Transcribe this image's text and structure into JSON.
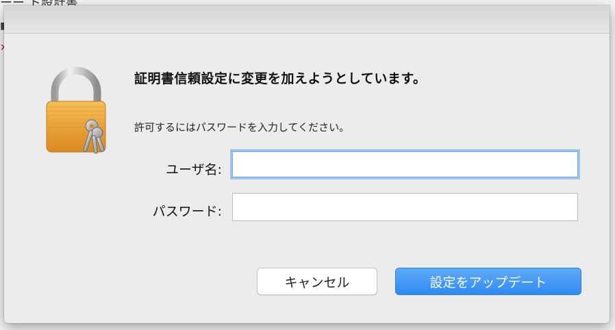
{
  "background": {
    "title_fragment": "ーー ト設計書"
  },
  "dialog": {
    "heading": "証明書信頼設定に変更を加えようとしています。",
    "subtext": "許可するにはパスワードを入力してください。",
    "username_label": "ユーザ名:",
    "username_value": "",
    "password_label": "パスワード:",
    "password_value": "",
    "cancel_button": "キャンセル",
    "update_button": "設定をアップデート"
  },
  "colors": {
    "accent": "#3d93f5",
    "focus_ring": "#9cc3f2"
  }
}
